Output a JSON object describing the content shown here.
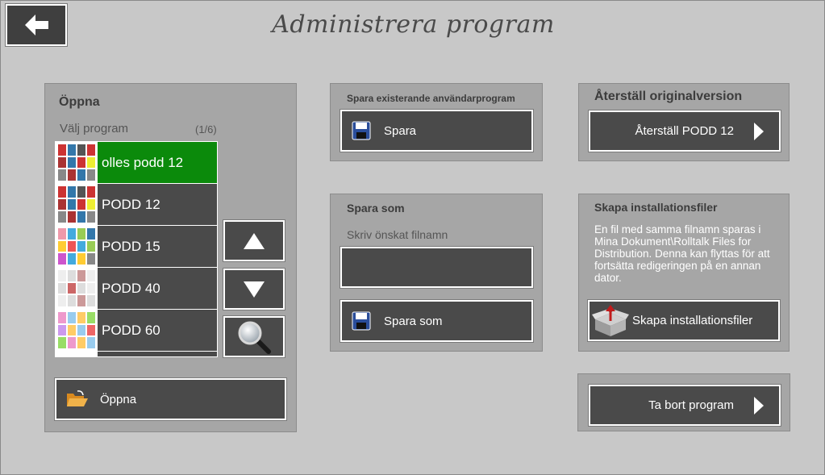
{
  "page": {
    "title": "Administrera program"
  },
  "back": {
    "icon": "back-arrow-icon"
  },
  "open_panel": {
    "title": "Öppna",
    "choose_label": "Välj program",
    "count": "(1/6)",
    "items": [
      {
        "label": "olles podd 12",
        "selected": true
      },
      {
        "label": "PODD 12",
        "selected": false
      },
      {
        "label": "PODD 15",
        "selected": false
      },
      {
        "label": "PODD 40",
        "selected": false
      },
      {
        "label": "PODD 60",
        "selected": false
      }
    ],
    "up_icon": "triangle-up-icon",
    "down_icon": "triangle-down-icon",
    "search_icon": "magnifier-icon",
    "open_button": "Öppna"
  },
  "save_panel": {
    "title": "Spara existerande användarprogram",
    "save_button": "Spara"
  },
  "saveas_panel": {
    "title": "Spara som",
    "filename_label": "Skriv önskat filnamn",
    "filename_value": "",
    "saveas_button": "Spara som"
  },
  "restore_panel": {
    "title": "Återställ originalversion",
    "restore_button": "Återställ PODD 12"
  },
  "install_panel": {
    "title": "Skapa installationsfiler",
    "description": "En fil med samma filnamn sparas i Mina Dokument\\Rolltalk Files for Distribution. Denna kan flyttas för att fortsätta redigeringen på en annan dator.",
    "install_button": "Skapa installationsfiler"
  },
  "delete_panel": {
    "delete_button": "Ta bort program"
  },
  "colors": {
    "background": "#c8c8c8",
    "panel": "#a6a6a6",
    "button": "#4a4a4a",
    "selected": "#0b8a0b"
  }
}
